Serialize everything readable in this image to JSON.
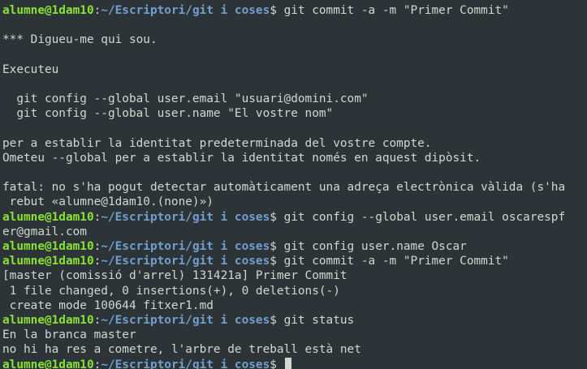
{
  "colors": {
    "background": "#2c3438",
    "text": "#d3d7cf",
    "prompt_user": "#8ae234",
    "prompt_path": "#729fcf"
  },
  "prompt": {
    "user_host": "alumne@1dam10",
    "colon": ":",
    "path": "~/Escriptori/git i coses",
    "dollar": "$ "
  },
  "lines": [
    {
      "type": "prompt",
      "command": "git commit -a -m \"Primer Commit\""
    },
    {
      "type": "output",
      "text": ""
    },
    {
      "type": "output",
      "text": "*** Digueu-me qui sou."
    },
    {
      "type": "output",
      "text": ""
    },
    {
      "type": "output",
      "text": "Executeu"
    },
    {
      "type": "output",
      "text": ""
    },
    {
      "type": "output",
      "text": "  git config --global user.email \"usuari@domini.com\""
    },
    {
      "type": "output",
      "text": "  git config --global user.name \"El vostre nom\""
    },
    {
      "type": "output",
      "text": ""
    },
    {
      "type": "output",
      "text": "per a establir la identitat predeterminada del vostre compte."
    },
    {
      "type": "output",
      "text": "Ometeu --global per a establir la identitat només en aquest dipòsit."
    },
    {
      "type": "output",
      "text": ""
    },
    {
      "type": "output",
      "text": "fatal: no s'ha pogut detectar automàticament una adreça electrònica vàlida (s'ha"
    },
    {
      "type": "output",
      "text": " rebut «alumne@1dam10.(none)»)"
    },
    {
      "type": "prompt",
      "command": "git config --global user.email oscarespf"
    },
    {
      "type": "output",
      "text": "er@gmail.com"
    },
    {
      "type": "prompt",
      "command": "git config user.name Oscar"
    },
    {
      "type": "prompt",
      "command": "git commit -a -m \"Primer Commit\""
    },
    {
      "type": "output",
      "text": "[master (comissió d'arrel) 131421a] Primer Commit"
    },
    {
      "type": "output",
      "text": " 1 file changed, 0 insertions(+), 0 deletions(-)"
    },
    {
      "type": "output",
      "text": " create mode 100644 fitxer1.md"
    },
    {
      "type": "prompt",
      "command": "git status"
    },
    {
      "type": "output",
      "text": "En la branca master"
    },
    {
      "type": "output",
      "text": "no hi ha res a cometre, l'arbre de treball està net"
    },
    {
      "type": "prompt",
      "command": "",
      "cursor": true
    }
  ]
}
